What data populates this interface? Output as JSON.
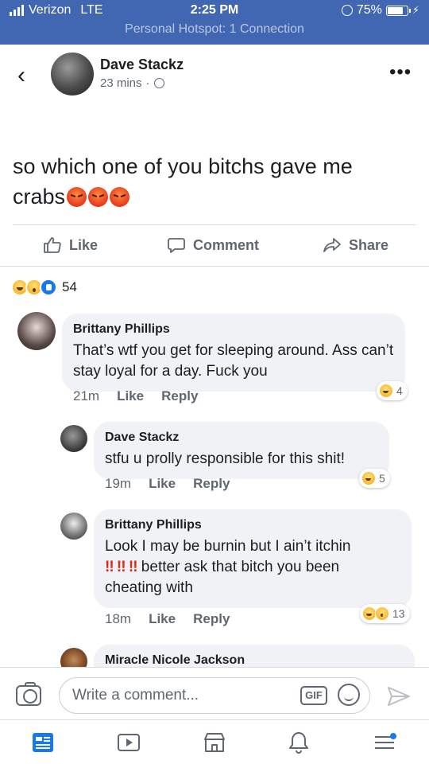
{
  "status_bar": {
    "carrier": "Verizon",
    "network": "LTE",
    "time": "2:25 PM",
    "battery": "75%",
    "hotspot": "Personal Hotspot: 1 Connection",
    "battery_level": 0.75
  },
  "post": {
    "author": "Dave Stackz",
    "time": "23 mins",
    "separator": "·",
    "privacy_icon": "globe-icon",
    "text": "so which one of you bitchs gave me crabs",
    "text_emojis": [
      "angry-emoji",
      "angry-emoji",
      "angry-emoji"
    ],
    "more_icon": "more-options-icon",
    "more_glyph": "•••",
    "back_glyph": "‹",
    "actions": {
      "like": "Like",
      "comment": "Comment",
      "share": "Share"
    },
    "reaction_icons": [
      "haha-icon",
      "wow-icon",
      "like-reaction-icon"
    ],
    "reaction_count": "54"
  },
  "comments": [
    {
      "author": "Brittany Phillips",
      "text": "That’s wtf you get for sleeping around. Ass can’t stay loyal for a day. Fuck you",
      "time": "21m",
      "like": "Like",
      "reply": "Reply",
      "reaction_icons": [
        "haha-icon"
      ],
      "reaction_count": "4"
    },
    {
      "author": "Dave Stackz",
      "text": "stfu u prolly responsible for this shit!",
      "time": "19m",
      "like": "Like",
      "reply": "Reply",
      "reaction_icons": [
        "haha-icon"
      ],
      "reaction_count": "5"
    },
    {
      "author": "Brittany Phillips",
      "text_line1": "Look I may be burnin but I ain’t itchin",
      "bangs": "!! !! !!",
      "text_line2": " better ask that bitch you been",
      "text_line3": "cheating with",
      "time": "18m",
      "like": "Like",
      "reply": "Reply",
      "reaction_icons": [
        "haha-icon",
        "wow-icon"
      ],
      "reaction_count": "13"
    },
    {
      "author": "Miracle Nicole Jackson"
    }
  ],
  "composer": {
    "placeholder": "Write a comment...",
    "gif_label": "GIF",
    "icons": [
      "camera-icon",
      "gif-icon",
      "emoji-icon",
      "send-icon"
    ]
  },
  "tab_bar": {
    "icons": [
      "news-feed-icon",
      "watch-icon",
      "marketplace-icon",
      "notifications-icon",
      "menu-icon"
    ]
  },
  "colors": {
    "facebook_blue": "#4267b2",
    "bubble_grey": "#f0f2f5",
    "secondary_text": "#606770",
    "like_blue": "#1877f2"
  }
}
